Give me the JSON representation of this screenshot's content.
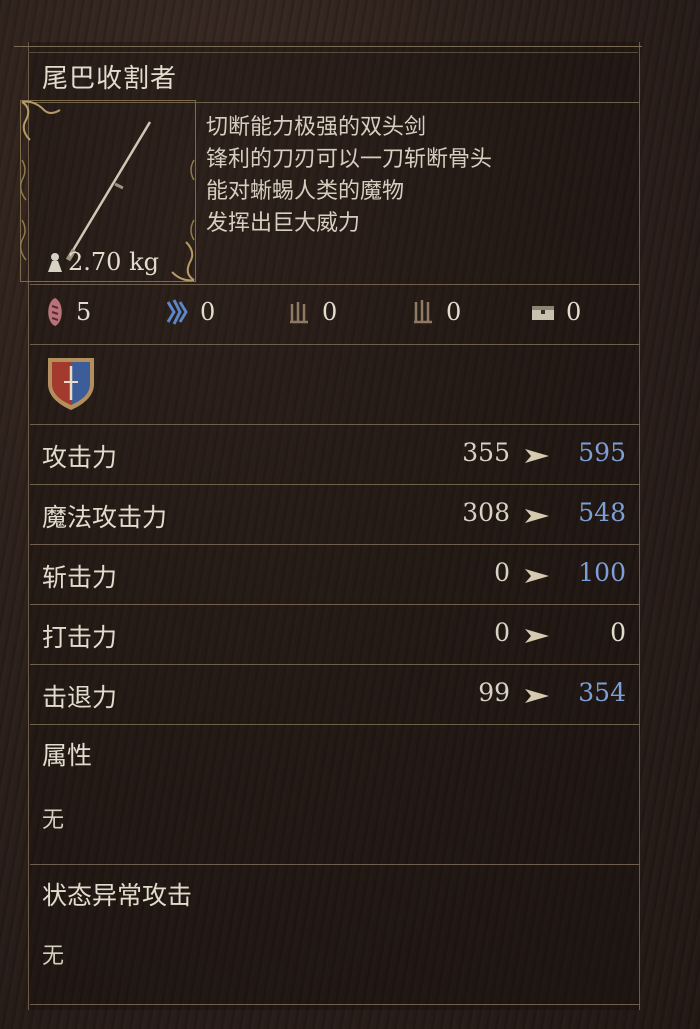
{
  "item": {
    "name": "尾巴收割者",
    "weight": "2.70 kg",
    "description": [
      "切断能力极强的双头剑",
      "锋利的刀刃可以一刀斩断骨头",
      "能对蜥蜴人类的魔物",
      "发挥出巨大威力"
    ]
  },
  "requirements": [
    {
      "icon": "strength-requirement-icon",
      "value": "5"
    },
    {
      "icon": "intelligence-requirement-icon",
      "value": "0"
    },
    {
      "icon": "faith-requirement-icon",
      "value": "0"
    },
    {
      "icon": "dexterity-requirement-icon",
      "value": "0"
    },
    {
      "icon": "storage-chest-icon",
      "value": "0"
    }
  ],
  "weapon_type_icon": "vocation-shield-icon",
  "stats": [
    {
      "label": "攻击力",
      "old": "355",
      "new": "595",
      "improved": true
    },
    {
      "label": "魔法攻击力",
      "old": "308",
      "new": "548",
      "improved": true
    },
    {
      "label": "斩击力",
      "old": "0",
      "new": "100",
      "improved": true
    },
    {
      "label": "打击力",
      "old": "0",
      "new": "0",
      "improved": false
    },
    {
      "label": "击退力",
      "old": "99",
      "new": "354",
      "improved": true
    }
  ],
  "element": {
    "label": "属性",
    "value": "无"
  },
  "status_ailment": {
    "label": "状态异常攻击",
    "value": "无"
  },
  "colors": {
    "improved": "#7c9fd8",
    "normal": "#e2dccd",
    "gold": "#b49a64"
  }
}
